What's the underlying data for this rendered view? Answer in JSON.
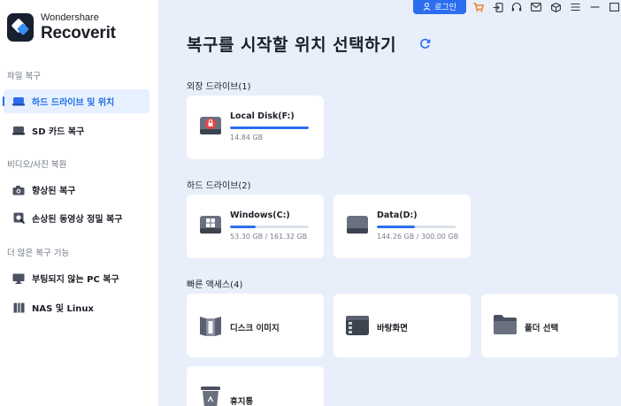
{
  "brand": {
    "line1": "Wondershare",
    "line2": "Recoverit"
  },
  "sidebar": {
    "sections": [
      {
        "title": "파일 복구"
      },
      {
        "title": "비디오/사진 복원"
      },
      {
        "title": "더 많은 복구 기능"
      }
    ],
    "items": [
      {
        "label": "하드 드라이브 및 위치",
        "active": true
      },
      {
        "label": "SD 카드 복구"
      },
      {
        "label": "향상된 복구"
      },
      {
        "label": "손상된 동영상 정밀 복구"
      },
      {
        "label": "부팅되지 않는 PC 복구"
      },
      {
        "label": "NAS 및 Linux"
      }
    ]
  },
  "topbar": {
    "login_label": "로그인"
  },
  "main": {
    "title": "복구를 시작할 위치 선택하기",
    "groups": {
      "external": {
        "title": "외장 드라이브(1)"
      },
      "hard": {
        "title": "하드 드라이브(2)"
      },
      "quick": {
        "title": "빠른 액세스(4)"
      }
    },
    "external_drives": [
      {
        "name": "Local Disk(F:)",
        "size": "14.84 GB",
        "used_fraction": 1.0
      }
    ],
    "hard_drives": [
      {
        "name": "Windows(C:)",
        "size": "53.30 GB / 161.32 GB",
        "used_fraction": 0.33
      },
      {
        "name": "Data(D:)",
        "size": "144.26 GB / 300.00 GB",
        "used_fraction": 0.48
      }
    ],
    "quick_access": [
      {
        "label": "디스크 이미지",
        "icon": "disk-image-icon"
      },
      {
        "label": "바탕화면",
        "icon": "desktop-icon"
      },
      {
        "label": "폴더 선택",
        "icon": "folder-icon"
      },
      {
        "label": "휴지통",
        "icon": "recycle-bin-icon"
      }
    ]
  },
  "colors": {
    "accent": "#2d6ef0",
    "sidebar_active_bg": "#e6f0fe",
    "main_bg": "#e8effb"
  }
}
